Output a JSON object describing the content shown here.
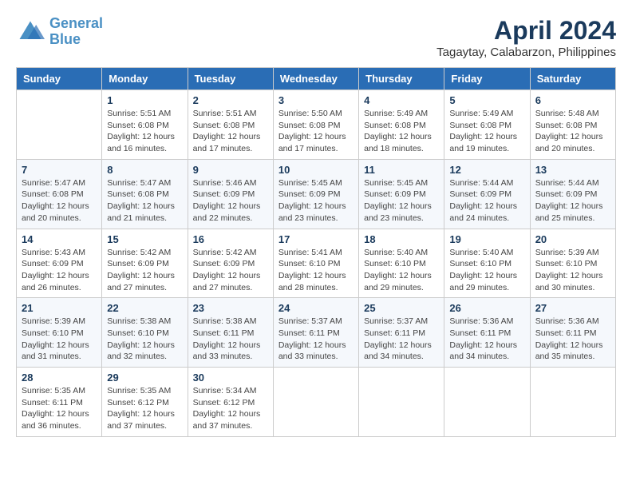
{
  "logo": {
    "text_general": "General",
    "text_blue": "Blue"
  },
  "title": "April 2024",
  "subtitle": "Tagaytay, Calabarzon, Philippines",
  "headers": [
    "Sunday",
    "Monday",
    "Tuesday",
    "Wednesday",
    "Thursday",
    "Friday",
    "Saturday"
  ],
  "weeks": [
    [
      {
        "day": "",
        "info": ""
      },
      {
        "day": "1",
        "info": "Sunrise: 5:51 AM\nSunset: 6:08 PM\nDaylight: 12 hours and 16 minutes."
      },
      {
        "day": "2",
        "info": "Sunrise: 5:51 AM\nSunset: 6:08 PM\nDaylight: 12 hours and 17 minutes."
      },
      {
        "day": "3",
        "info": "Sunrise: 5:50 AM\nSunset: 6:08 PM\nDaylight: 12 hours and 17 minutes."
      },
      {
        "day": "4",
        "info": "Sunrise: 5:49 AM\nSunset: 6:08 PM\nDaylight: 12 hours and 18 minutes."
      },
      {
        "day": "5",
        "info": "Sunrise: 5:49 AM\nSunset: 6:08 PM\nDaylight: 12 hours and 19 minutes."
      },
      {
        "day": "6",
        "info": "Sunrise: 5:48 AM\nSunset: 6:08 PM\nDaylight: 12 hours and 20 minutes."
      }
    ],
    [
      {
        "day": "7",
        "info": "Sunrise: 5:47 AM\nSunset: 6:08 PM\nDaylight: 12 hours and 20 minutes."
      },
      {
        "day": "8",
        "info": "Sunrise: 5:47 AM\nSunset: 6:08 PM\nDaylight: 12 hours and 21 minutes."
      },
      {
        "day": "9",
        "info": "Sunrise: 5:46 AM\nSunset: 6:09 PM\nDaylight: 12 hours and 22 minutes."
      },
      {
        "day": "10",
        "info": "Sunrise: 5:45 AM\nSunset: 6:09 PM\nDaylight: 12 hours and 23 minutes."
      },
      {
        "day": "11",
        "info": "Sunrise: 5:45 AM\nSunset: 6:09 PM\nDaylight: 12 hours and 23 minutes."
      },
      {
        "day": "12",
        "info": "Sunrise: 5:44 AM\nSunset: 6:09 PM\nDaylight: 12 hours and 24 minutes."
      },
      {
        "day": "13",
        "info": "Sunrise: 5:44 AM\nSunset: 6:09 PM\nDaylight: 12 hours and 25 minutes."
      }
    ],
    [
      {
        "day": "14",
        "info": "Sunrise: 5:43 AM\nSunset: 6:09 PM\nDaylight: 12 hours and 26 minutes."
      },
      {
        "day": "15",
        "info": "Sunrise: 5:42 AM\nSunset: 6:09 PM\nDaylight: 12 hours and 27 minutes."
      },
      {
        "day": "16",
        "info": "Sunrise: 5:42 AM\nSunset: 6:09 PM\nDaylight: 12 hours and 27 minutes."
      },
      {
        "day": "17",
        "info": "Sunrise: 5:41 AM\nSunset: 6:10 PM\nDaylight: 12 hours and 28 minutes."
      },
      {
        "day": "18",
        "info": "Sunrise: 5:40 AM\nSunset: 6:10 PM\nDaylight: 12 hours and 29 minutes."
      },
      {
        "day": "19",
        "info": "Sunrise: 5:40 AM\nSunset: 6:10 PM\nDaylight: 12 hours and 29 minutes."
      },
      {
        "day": "20",
        "info": "Sunrise: 5:39 AM\nSunset: 6:10 PM\nDaylight: 12 hours and 30 minutes."
      }
    ],
    [
      {
        "day": "21",
        "info": "Sunrise: 5:39 AM\nSunset: 6:10 PM\nDaylight: 12 hours and 31 minutes."
      },
      {
        "day": "22",
        "info": "Sunrise: 5:38 AM\nSunset: 6:10 PM\nDaylight: 12 hours and 32 minutes."
      },
      {
        "day": "23",
        "info": "Sunrise: 5:38 AM\nSunset: 6:11 PM\nDaylight: 12 hours and 33 minutes."
      },
      {
        "day": "24",
        "info": "Sunrise: 5:37 AM\nSunset: 6:11 PM\nDaylight: 12 hours and 33 minutes."
      },
      {
        "day": "25",
        "info": "Sunrise: 5:37 AM\nSunset: 6:11 PM\nDaylight: 12 hours and 34 minutes."
      },
      {
        "day": "26",
        "info": "Sunrise: 5:36 AM\nSunset: 6:11 PM\nDaylight: 12 hours and 34 minutes."
      },
      {
        "day": "27",
        "info": "Sunrise: 5:36 AM\nSunset: 6:11 PM\nDaylight: 12 hours and 35 minutes."
      }
    ],
    [
      {
        "day": "28",
        "info": "Sunrise: 5:35 AM\nSunset: 6:11 PM\nDaylight: 12 hours and 36 minutes."
      },
      {
        "day": "29",
        "info": "Sunrise: 5:35 AM\nSunset: 6:12 PM\nDaylight: 12 hours and 37 minutes."
      },
      {
        "day": "30",
        "info": "Sunrise: 5:34 AM\nSunset: 6:12 PM\nDaylight: 12 hours and 37 minutes."
      },
      {
        "day": "",
        "info": ""
      },
      {
        "day": "",
        "info": ""
      },
      {
        "day": "",
        "info": ""
      },
      {
        "day": "",
        "info": ""
      }
    ]
  ]
}
